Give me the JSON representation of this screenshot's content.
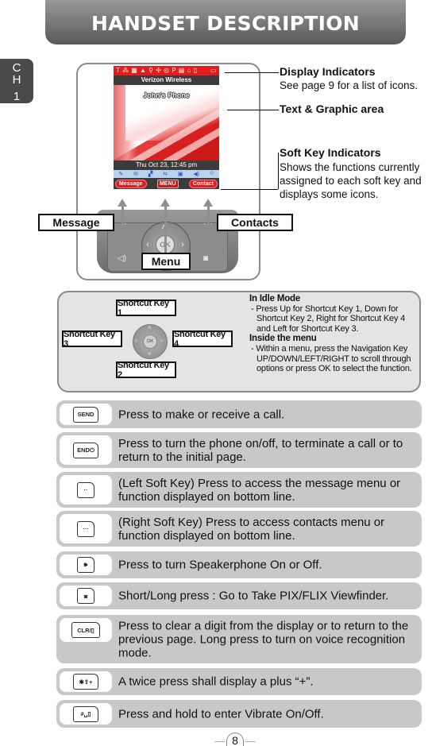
{
  "header": {
    "title": "HANDSET DESCRIPTION"
  },
  "chapter": {
    "letters": [
      "C",
      "H"
    ],
    "number": "1"
  },
  "phone_screen": {
    "status_icons": "T ⁂ ▦ ▲ ⚲ ✣ ◎ P ▤ ⌂ ▯",
    "battery_icon": "▭",
    "carrier": "Verizon Wireless",
    "owner_name": "John's Phone",
    "datetime": "Thu Oct 23, 12:45 pm",
    "tray_icons": [
      "✎",
      "✉",
      "▞",
      "⇆",
      "▣",
      "◀)",
      "⟐"
    ],
    "softkeys": {
      "left": "Message",
      "center": "MENU",
      "right": "Contact"
    }
  },
  "phone_keypad": {
    "ok_label": "OK"
  },
  "labels": {
    "message": "Message",
    "contacts": "Contacts",
    "menu": "Menu"
  },
  "callouts": [
    {
      "title": "Display Indicators",
      "desc": "See page 9 for a list of icons."
    },
    {
      "title": "Text & Graphic area",
      "desc": ""
    },
    {
      "title": "Soft Key Indicators",
      "desc": "Shows the functions currently assigned to each soft key and displays some icons."
    }
  ],
  "shortcuts": {
    "keys": [
      "Shortcut Key 1",
      "Shortcut Key 2",
      "Shortcut Key 3",
      "Shortcut Key 4"
    ],
    "ok_label": "OK",
    "idle_heading": "In Idle Mode",
    "idle_text": "- Press Up for Shortcut Key 1, Down for Shortcut Key 2, Right for Shortcut Key 4 and Left for Shortcut Key 3.",
    "menu_heading": "Inside the menu",
    "menu_text": "- Within a menu, press the Navigation Key UP/DOWN/LEFT/RIGHT to scroll through options or press OK to select the function."
  },
  "key_rows": [
    {
      "key": "SEND",
      "icon": "send-key-icon",
      "desc": "Press to make or receive a call."
    },
    {
      "key": "END⏻",
      "icon": "end-key-icon",
      "desc": "Press to turn the phone on/off, to terminate a call or to return to the initial page."
    },
    {
      "key": "··",
      "icon": "left-soft-key-icon",
      "desc": "(Left Soft Key) Press to access the message menu or function displayed on bottom line."
    },
    {
      "key": "···",
      "icon": "right-soft-key-icon",
      "desc": "(Right Soft Key) Press to access contacts menu or function displayed on bottom line."
    },
    {
      "key": "🕪",
      "icon": "speaker-key-icon",
      "desc": "Press to turn Speakerphone On or Off."
    },
    {
      "key": "◙",
      "icon": "camera-key-icon",
      "desc": "Short/Long press : Go to Take PIX/FLIX Viewfinder."
    },
    {
      "key": "CLR/▯",
      "icon": "clear-key-icon",
      "desc": "Press to clear a digit from the display or to return to the previous page. Long press to turn on voice recognition mode."
    },
    {
      "key": "✱⇧+",
      "icon": "star-key-icon",
      "desc": "A twice press shall display a plus “+”."
    },
    {
      "key": "#␣▯",
      "icon": "pound-key-icon",
      "desc": "Press and hold to enter Vibrate On/Off."
    }
  ],
  "page_number": "8"
}
